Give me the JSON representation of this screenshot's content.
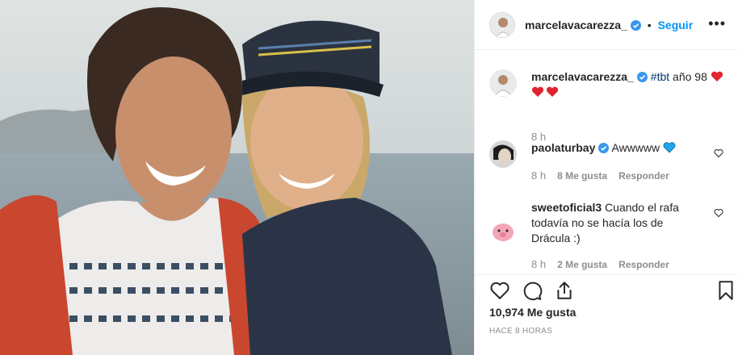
{
  "post": {
    "username": "marcelavacarezza_",
    "dot": "•",
    "follow": "Seguir",
    "more": "•••",
    "photo_description_icon": "photo"
  },
  "caption": {
    "username": "marcelavacarezza_",
    "hashtag": "#tbt",
    "text": "año 98",
    "time": "8 h"
  },
  "comments": [
    {
      "username": "paolaturbay",
      "text": "Awwwww",
      "time": "8 h",
      "likes": "8 Me gusta",
      "reply": "Responder"
    },
    {
      "username": "sweetoficial3",
      "text": "Cuando el rafa todavía no se hacía los de Drácula :)",
      "time": "8 h",
      "likes": "2 Me gusta",
      "reply": "Responder"
    }
  ],
  "stats": {
    "likes": "10,974 Me gusta",
    "posted": "HACE 8 HORAS"
  },
  "colors": {
    "accent": "#0095f6",
    "heart_red": "#ed4956",
    "heart_blue": "#1da1f2"
  }
}
